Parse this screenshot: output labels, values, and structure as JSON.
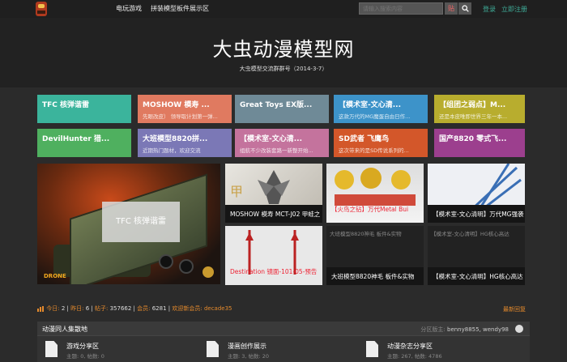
{
  "nav": {
    "links": [
      "电玩游戏",
      "拼装模型板件展示区"
    ],
    "search_placeholder": "请输入搜索内容",
    "search_tag": "贴",
    "login": "登录",
    "register": "立即注册"
  },
  "header": {
    "title": "大虫动漫模型网",
    "subtitle": "大虫模型交流群群号（2014-3-7）"
  },
  "tiles": [
    {
      "title": "TFC 核弹谐雷",
      "sub": "",
      "color": "#3bb49c"
    },
    {
      "title": "MOSHOW 模寿 ...",
      "sub": "先眼改皮） 领导取计划第一弹...",
      "color": "#e07a60"
    },
    {
      "title": "Great Toys EX版...",
      "sub": "",
      "color": "#6f8a97"
    },
    {
      "title": "【模术室-文心清...",
      "sub": "这款万代的MG魔蛋自由日作...",
      "color": "#3d93c9"
    },
    {
      "title": "【组团之弱点】M...",
      "sub": "还是本皮唯即世界三年一本...",
      "color": "#b8ad2e"
    },
    {
      "title": "DevilHunter 猎...",
      "sub": "",
      "color": "#4fb05f"
    },
    {
      "title": "大班模型8820拼...",
      "sub": "近期热门题材，欢迎交流",
      "color": "#7b78b6"
    },
    {
      "title": "【模术室-文心清...",
      "sub": "组航不少改装套路一新整开始...",
      "color": "#c4739d"
    },
    {
      "title": "SD武者 飞鹰鸟",
      "sub": "这次带来的是SD传说系列的...",
      "color": "#d3572a"
    },
    {
      "title": "国产8820 零式飞...",
      "sub": "",
      "color": "#9c3f8e"
    }
  ],
  "gallery": {
    "big_caption": "TFC 核弹谐雷",
    "big_logo": "DRONE",
    "thumbs": [
      {
        "caption": "MOSHOW 模寿 MCT-J02 甲蛙之"
      },
      {
        "caption": "【火鸟之钻】万代Metal Bui"
      },
      {
        "caption": "【模术室-文心清明】万代MG强袭"
      },
      {
        "caption": "Destination 镜面-101-05-预告"
      },
      {
        "caption": "大班模型8820神毛 板件&实物",
        "broken": "大班模型8820神毛 板件&实物"
      },
      {
        "caption": "【模术室-文心清明】HG核心高达",
        "broken": "【模术室-文心清明】HG核心高达"
      }
    ]
  },
  "stats": {
    "today_label": "今日:",
    "today": "2",
    "yesterday_label": "昨日:",
    "yesterday": "6",
    "posts_label": "帖子:",
    "posts": "357662",
    "members_label": "会员:",
    "members": "6281",
    "welcome_label": "欢迎新会员:",
    "newest_member": "decade35",
    "newest_reply": "最新回复"
  },
  "forum": {
    "title": "动漫同人集散地",
    "mods_label": "分区版主:",
    "mods": "benny8855, wendy98",
    "boards": [
      {
        "name": "游戏分享区",
        "stats": "主题: 0, 帖数: 0"
      },
      {
        "name": "漫画创作展示",
        "stats": "主题: 3, 帖数: 20"
      },
      {
        "name": "动漫杂志分享区",
        "stats": "主题: 267, 帖数: 4786"
      }
    ]
  }
}
